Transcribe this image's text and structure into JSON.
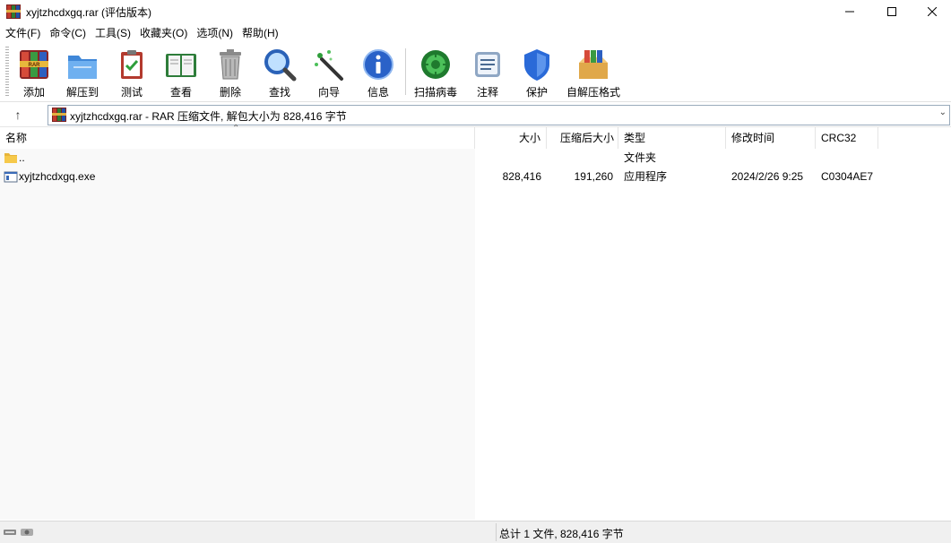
{
  "window": {
    "title": "xyjtzhcdxgq.rar (评估版本)",
    "minimize_glyph": "—",
    "maximize_glyph": "☐",
    "close_glyph": "✕"
  },
  "menu": [
    "文件(F)",
    "命令(C)",
    "工具(S)",
    "收藏夹(O)",
    "选项(N)",
    "帮助(H)"
  ],
  "toolbar": {
    "add": "添加",
    "extract": "解压到",
    "test": "测试",
    "view": "查看",
    "delete": "删除",
    "find": "查找",
    "wizard": "向导",
    "info": "信息",
    "scan": "扫描病毒",
    "comment": "注释",
    "protect": "保护",
    "sfx": "自解压格式"
  },
  "address": {
    "text": "xyjtzhcdxgq.rar - RAR 压缩文件, 解包大小为 828,416 字节",
    "up_glyph": "↑",
    "dropdown_glyph": "⌄"
  },
  "columns": {
    "name": "名称",
    "size": "大小",
    "packed": "压缩后大小",
    "type": "类型",
    "modified": "修改时间",
    "crc": "CRC32",
    "sort_glyph": "⌃"
  },
  "files": [
    {
      "name": "..",
      "size": "",
      "packed": "",
      "type": "文件夹",
      "modified": "",
      "crc": "",
      "icon": "folder-icon"
    },
    {
      "name": "xyjtzhcdxgq.exe",
      "size": "828,416",
      "packed": "191,260",
      "type": "应用程序",
      "modified": "2024/2/26 9:25",
      "crc": "C0304AE7",
      "icon": "exe-file-icon"
    }
  ],
  "status": {
    "text": "总计 1 文件, 828,416 字节"
  },
  "colors": {
    "accent_blue": "#1f6fd1",
    "folder_yellow": "#f6c94a",
    "scan_green": "#2e9e3a"
  }
}
